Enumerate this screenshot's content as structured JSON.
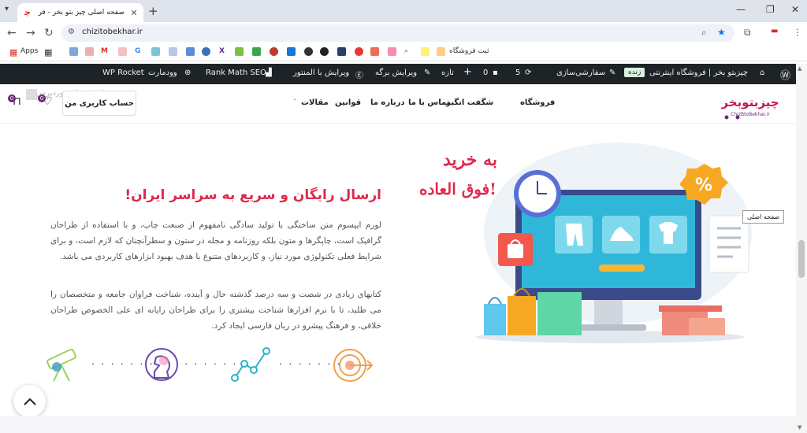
{
  "browser": {
    "tab_title": "صفحه اصلی چیز بتو بخر - فروشگاه",
    "tab_favicon": "chizbtobekhar-favicon",
    "new_tab_icon": "+",
    "url": "chizitobekhar.ir",
    "window_controls": [
      "minimize",
      "maximize",
      "close"
    ]
  },
  "bookmarks": {
    "apps_label": "Apps",
    "store_signup_label": "ثبت فروشگاه"
  },
  "wpbar": {
    "site_name": "چیزبتو بخر | فروشگاه اینترنتی",
    "live_label": "زنده",
    "customize": "سفارشی‌سازی",
    "updates_count": "5",
    "comments_count": "0",
    "new_label": "تازه",
    "edit_page": "ویرایش برگه",
    "elementor_edit": "ویرایش با المنتور",
    "rank_math": "Rank Math SEO",
    "woodmart": "وودمارت",
    "wp_rocket": "WP Rocket"
  },
  "header": {
    "logo_text": "چیزبتوبخر",
    "logo_subtext": "ChizBtoBekhar.ir",
    "menu": [
      "فروشگاه",
      "شگفت انگیز",
      "تماس با ما",
      "درباره ما",
      "قوانین",
      "مقالات"
    ],
    "account_button": "حساب کاربری من",
    "cart_count": "0",
    "wishlist_count": "0",
    "ghost_text": "سفارشی‌سازی وردپرس"
  },
  "hero": {
    "art_line1": "به خرید",
    "art_line2": "فوق العاده!",
    "title": "ارسال رایگان و سریع به سراسر ایران!",
    "paragraph1": "لورم ایپسوم متن ساختگی با تولید سادگی نامفهوم از صنعت چاپ، و با استفاده از طراحان گرافیک است، چاپگرها و متون بلکه روزنامه و مجله در ستون و سطرآنچنان که لازم است، و برای شرایط فعلی تکنولوژی مورد نیاز، و کاربردهای متنوع با هدف بهبود ابزارهای کاربردی می باشد.",
    "paragraph2": "کتابهای زیادی در شصت و سه درصد گذشته حال و آینده، شناخت فراوان جامعه و متخصصان را می طلبد، تا با نرم افزارها شناخت بیشتری را برای طراحان رایانه ای علی الخصوص طراحان خلاقی، و فرهنگ پیشرو در زبان فارسی ایجاد کرد.",
    "dots": "· · · · · · ·",
    "process_icons": [
      "target-icon",
      "growth-chart-icon",
      "chess-knight-icon",
      "telescope-icon"
    ]
  },
  "tooltip": "صفحه اصلی",
  "colors": {
    "accent": "#e0284a",
    "wpbar": "#1d2327",
    "badge": "#6a2a7a"
  }
}
